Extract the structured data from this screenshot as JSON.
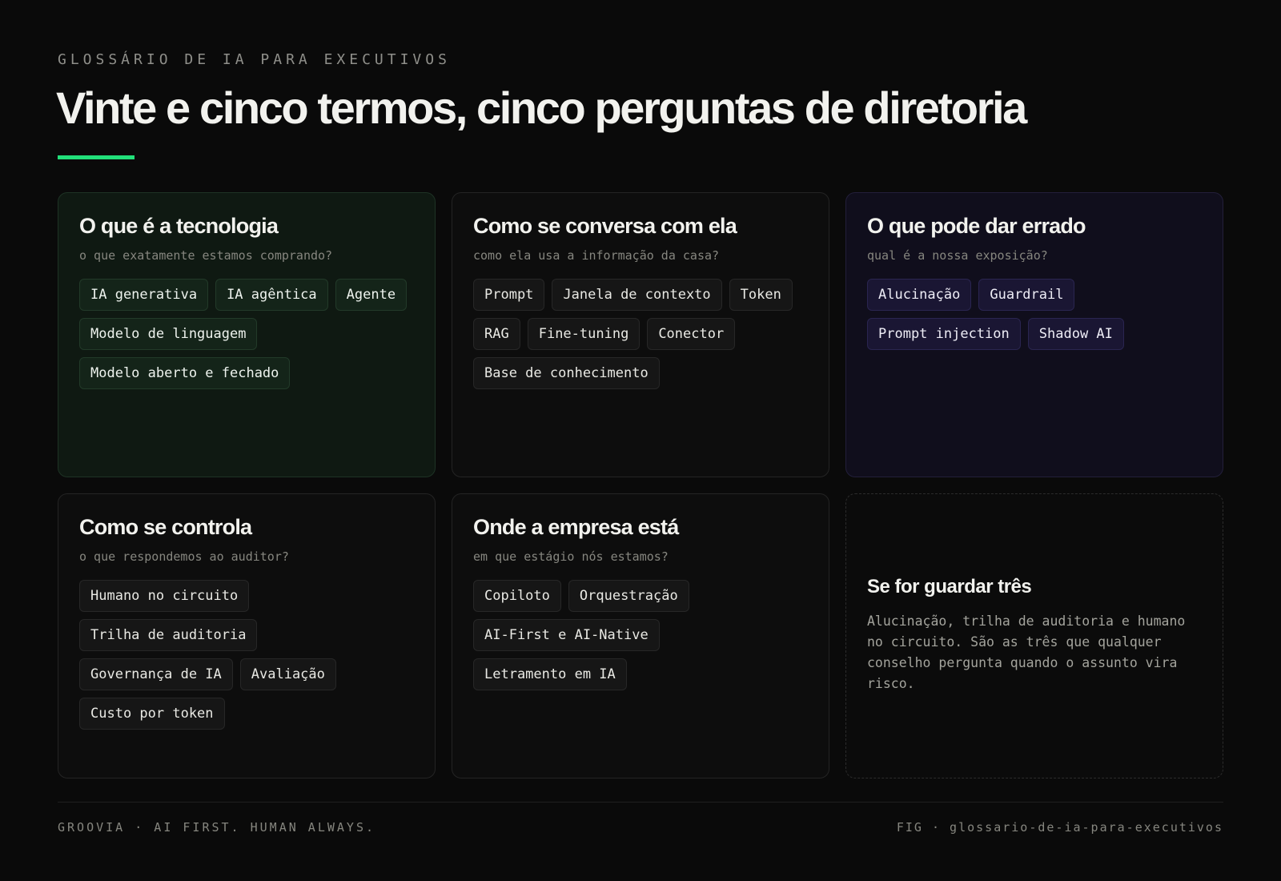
{
  "header": {
    "eyebrow": "GLOSSÁRIO DE IA PARA EXECUTIVOS",
    "title": "Vinte e cinco termos, cinco perguntas de diretoria"
  },
  "colors": {
    "accent": "#22e07a",
    "background": "#0a0a0a",
    "card_green": "#0f1912",
    "card_purple": "#100e1c"
  },
  "cards": [
    {
      "title": "O que é a tecnologia",
      "subtitle": "o que exatamente estamos comprando?",
      "terms": [
        "IA generativa",
        "IA agêntica",
        "Agente",
        "Modelo de linguagem",
        "Modelo aberto e fechado"
      ]
    },
    {
      "title": "Como se conversa com ela",
      "subtitle": "como ela usa a informação da casa?",
      "terms": [
        "Prompt",
        "Janela de contexto",
        "Token",
        "RAG",
        "Fine-tuning",
        "Conector",
        "Base de conhecimento"
      ]
    },
    {
      "title": "O que pode dar errado",
      "subtitle": "qual é a nossa exposição?",
      "terms": [
        "Alucinação",
        "Guardrail",
        "Prompt injection",
        "Shadow AI"
      ]
    },
    {
      "title": "Como se controla",
      "subtitle": "o que respondemos ao auditor?",
      "terms": [
        "Humano no circuito",
        "Trilha de auditoria",
        "Governança de IA",
        "Avaliação",
        "Custo por token"
      ]
    },
    {
      "title": "Onde a empresa está",
      "subtitle": "em que estágio nós estamos?",
      "terms": [
        "Copiloto",
        "Orquestração",
        "AI-First e AI-Native",
        "Letramento em IA"
      ]
    }
  ],
  "keep_three": {
    "title": "Se for guardar três",
    "text": "Alucinação, trilha de auditoria e humano no circuito. São as três que qualquer conselho pergunta quando o assunto vira risco."
  },
  "footer": {
    "left": "GROOVIA · AI FIRST. HUMAN ALWAYS.",
    "right": "FIG · glossario-de-ia-para-executivos"
  }
}
